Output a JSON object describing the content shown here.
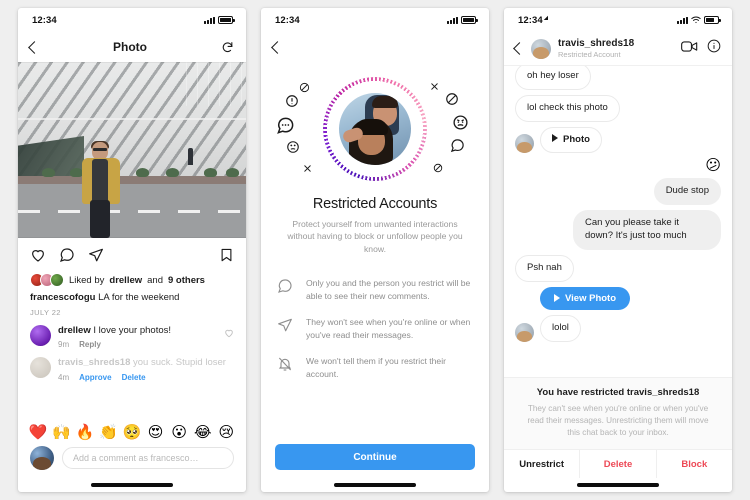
{
  "theme": {
    "page_bg": "#efefef",
    "accent_blue": "#3897f0",
    "danger_red": "#ed4956",
    "muted_grey": "#8e8e8e"
  },
  "phone1": {
    "status": {
      "time": "12:34",
      "signal_icon": "signal-bars-icon",
      "battery_icon": "battery-icon"
    },
    "nav": {
      "back_icon": "back-chevron-icon",
      "title": "Photo",
      "refresh_icon": "refresh-icon"
    },
    "photo_alt": "man-in-yellow-jacket-at-the-broad-museum",
    "actions": {
      "like_icon": "heart-icon",
      "comment_icon": "comment-icon",
      "share_icon": "share-paperplane-icon",
      "save_icon": "bookmark-icon"
    },
    "likes": {
      "prefix": "Liked by ",
      "name": "drellew",
      "middle": " and ",
      "others": "9 others"
    },
    "caption": {
      "username": "francescofogu",
      "text": "LA for the weekend"
    },
    "date": "JULY 22",
    "comments": [
      {
        "username": "drellew",
        "text": "I love your photos!",
        "time": "9m",
        "action": "Reply",
        "restricted": false,
        "like_icon": "heart-outline-icon"
      },
      {
        "username": "travis_shreds18",
        "text": "you suck. Stupid loser",
        "time": "4m",
        "approve_label": "Approve",
        "delete_label": "Delete",
        "restricted": true
      }
    ],
    "emoji_row": [
      "❤️",
      "🙌",
      "🔥",
      "👏",
      "🥺",
      "😍",
      "😮",
      "😂",
      "😢"
    ],
    "composer": {
      "placeholder": "Add a comment as francesco…",
      "avatar": "user-avatar"
    }
  },
  "phone2": {
    "status": {
      "time": "12:34"
    },
    "nav": {
      "back_icon": "back-chevron-icon"
    },
    "illustration": {
      "avatar_alt": "two-friends-selfie",
      "ring": "dotted-gradient-ring",
      "left_icons": [
        "no-entry-icon",
        "exclamation-circle-icon",
        "comment-dots-icon",
        "sad-face-icon",
        "x-icon"
      ],
      "right_icons": [
        "x-icon",
        "no-entry-icon",
        "angry-face-icon",
        "comment-bubble-icon",
        "no-entry-small-icon"
      ]
    },
    "title": "Restricted Accounts",
    "subtitle": "Protect yourself from unwanted interactions without having to block or unfollow people you know.",
    "bullets": [
      {
        "icon": "comment-icon",
        "text": "Only you and the person you restrict will be able to see their new comments."
      },
      {
        "icon": "paperplane-icon",
        "text": "They won't see when you're online or when you've read their messages."
      },
      {
        "icon": "bell-slash-icon",
        "text": "We won't tell them if you restrict their account."
      }
    ],
    "cta": {
      "label": "Continue",
      "color": "#3897f0"
    }
  },
  "phone3": {
    "status": {
      "time": "12:34",
      "location_icon": "location-arrow-icon",
      "wifi_icon": "wifi-icon"
    },
    "header": {
      "back_icon": "back-chevron-icon",
      "avatar": "contact-avatar",
      "name": "travis_shreds18",
      "subtitle": "Restricted Account",
      "video_icon": "video-call-icon",
      "info_icon": "info-circle-icon"
    },
    "messages": [
      {
        "from": "them",
        "text": "oh hey loser",
        "type": "text",
        "clipped": true
      },
      {
        "from": "them",
        "text": "lol check this photo",
        "type": "text"
      },
      {
        "from": "them",
        "text": "Photo",
        "type": "media",
        "icon": "play-icon",
        "avatar": true
      },
      {
        "from": "me",
        "text": "😕",
        "type": "reaction"
      },
      {
        "from": "me",
        "text": "Dude stop",
        "type": "text"
      },
      {
        "from": "me",
        "text": "Can you please take it down? It's just too much",
        "type": "text"
      },
      {
        "from": "them",
        "text": "Psh nah",
        "type": "text"
      },
      {
        "from": "me",
        "text": "View Photo",
        "type": "button",
        "icon": "play-icon"
      },
      {
        "from": "them",
        "text": "lolol",
        "type": "text",
        "avatar": true
      }
    ],
    "notice": {
      "title": "You have restricted travis_shreds18",
      "body": "They can't see when you're online or when you've read their messages. Unrestricting them will move this chat back to your inbox."
    },
    "actions": [
      {
        "label": "Unrestrict",
        "color": "#1c1c1c"
      },
      {
        "label": "Delete",
        "color": "#ed4956"
      },
      {
        "label": "Block",
        "color": "#ed4956"
      }
    ]
  }
}
